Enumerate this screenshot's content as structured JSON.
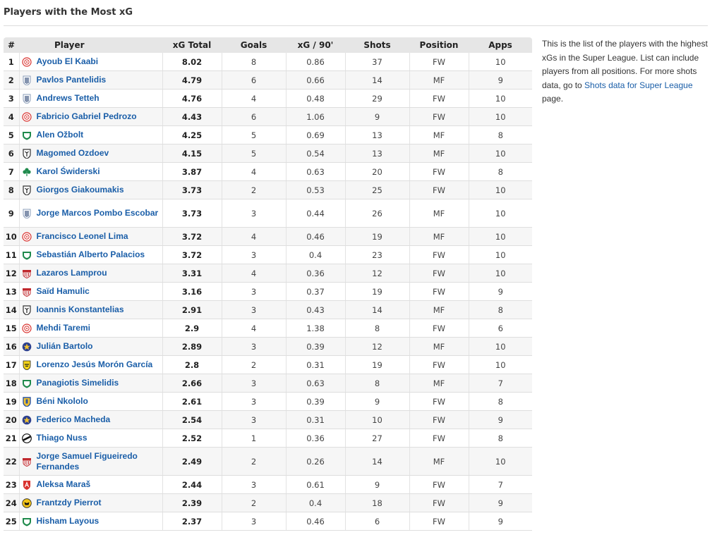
{
  "page": {
    "title": "Players with the Most xG"
  },
  "table": {
    "headers": {
      "rank": "#",
      "player": "Player",
      "xg_total": "xG Total",
      "goals": "Goals",
      "xg90": "xG / 90'",
      "shots": "Shots",
      "position": "Position",
      "apps": "Apps"
    },
    "rows": [
      {
        "rank": "1",
        "player": "Ayoub El Kaabi",
        "club_icon": "olympiacos-icon",
        "xg": "8.02",
        "goals": "8",
        "xg90": "0.86",
        "shots": "37",
        "pos": "FW",
        "apps": "10"
      },
      {
        "rank": "2",
        "player": "Pavlos Pantelidis",
        "club_icon": "atromitos-icon",
        "xg": "4.79",
        "goals": "6",
        "xg90": "0.66",
        "shots": "14",
        "pos": "MF",
        "apps": "9"
      },
      {
        "rank": "3",
        "player": "Andrews Tetteh",
        "club_icon": "atromitos-icon",
        "xg": "4.76",
        "goals": "4",
        "xg90": "0.48",
        "shots": "29",
        "pos": "FW",
        "apps": "10"
      },
      {
        "rank": "4",
        "player": "Fabricio Gabriel Pedrozo",
        "club_icon": "olympiacos-icon",
        "xg": "4.43",
        "goals": "6",
        "xg90": "1.06",
        "shots": "9",
        "pos": "FW",
        "apps": "10"
      },
      {
        "rank": "5",
        "player": "Alen Ožbolt",
        "club_icon": "panathinaikos-icon",
        "xg": "4.25",
        "goals": "5",
        "xg90": "0.69",
        "shots": "13",
        "pos": "MF",
        "apps": "8"
      },
      {
        "rank": "6",
        "player": "Magomed Ozdoev",
        "club_icon": "paok-icon",
        "xg": "4.15",
        "goals": "5",
        "xg90": "0.54",
        "shots": "13",
        "pos": "MF",
        "apps": "10"
      },
      {
        "rank": "7",
        "player": "Karol Świderski",
        "club_icon": "panathinaikos-clover-icon",
        "xg": "3.87",
        "goals": "4",
        "xg90": "0.63",
        "shots": "20",
        "pos": "FW",
        "apps": "8"
      },
      {
        "rank": "8",
        "player": "Giorgos Giakoumakis",
        "club_icon": "paok-icon",
        "xg": "3.73",
        "goals": "2",
        "xg90": "0.53",
        "shots": "25",
        "pos": "FW",
        "apps": "10"
      },
      {
        "rank": "9",
        "player": "Jorge Marcos Pombo Escobar",
        "club_icon": "atromitos-icon",
        "xg": "3.73",
        "goals": "3",
        "xg90": "0.44",
        "shots": "26",
        "pos": "MF",
        "apps": "10",
        "tall": true
      },
      {
        "rank": "10",
        "player": "Francisco Leonel Lima",
        "club_icon": "olympiacos-icon",
        "xg": "3.72",
        "goals": "4",
        "xg90": "0.46",
        "shots": "19",
        "pos": "MF",
        "apps": "10"
      },
      {
        "rank": "11",
        "player": "Sebastián Alberto Palacios",
        "club_icon": "panathinaikos-icon",
        "xg": "3.72",
        "goals": "3",
        "xg90": "0.4",
        "shots": "23",
        "pos": "FW",
        "apps": "10"
      },
      {
        "rank": "12",
        "player": "Lazaros Lamprou",
        "club_icon": "volos-icon",
        "xg": "3.31",
        "goals": "4",
        "xg90": "0.36",
        "shots": "12",
        "pos": "FW",
        "apps": "10"
      },
      {
        "rank": "13",
        "player": "Saïd Hamulic",
        "club_icon": "volos-icon",
        "xg": "3.16",
        "goals": "3",
        "xg90": "0.37",
        "shots": "19",
        "pos": "FW",
        "apps": "9"
      },
      {
        "rank": "14",
        "player": "Ioannis Konstantelias",
        "club_icon": "paok-icon",
        "xg": "2.91",
        "goals": "3",
        "xg90": "0.43",
        "shots": "14",
        "pos": "MF",
        "apps": "8"
      },
      {
        "rank": "15",
        "player": "Mehdi Taremi",
        "club_icon": "olympiacos-icon",
        "xg": "2.9",
        "goals": "4",
        "xg90": "1.38",
        "shots": "8",
        "pos": "FW",
        "apps": "6"
      },
      {
        "rank": "16",
        "player": "Julián Bartolo",
        "club_icon": "asteras-icon",
        "xg": "2.89",
        "goals": "3",
        "xg90": "0.39",
        "shots": "12",
        "pos": "MF",
        "apps": "10"
      },
      {
        "rank": "17",
        "player": "Lorenzo Jesús Morón García",
        "club_icon": "aris-icon",
        "xg": "2.8",
        "goals": "2",
        "xg90": "0.31",
        "shots": "19",
        "pos": "FW",
        "apps": "10"
      },
      {
        "rank": "18",
        "player": "Panagiotis Simelidis",
        "club_icon": "panathinaikos-icon",
        "xg": "2.66",
        "goals": "3",
        "xg90": "0.63",
        "shots": "8",
        "pos": "MF",
        "apps": "7"
      },
      {
        "rank": "19",
        "player": "Béni Nkololo",
        "club_icon": "panetolikos-icon",
        "xg": "2.61",
        "goals": "3",
        "xg90": "0.39",
        "shots": "9",
        "pos": "FW",
        "apps": "8"
      },
      {
        "rank": "20",
        "player": "Federico Macheda",
        "club_icon": "asteras-icon",
        "xg": "2.54",
        "goals": "3",
        "xg90": "0.31",
        "shots": "10",
        "pos": "FW",
        "apps": "9"
      },
      {
        "rank": "21",
        "player": "Thiago Nuss",
        "club_icon": "ofi-icon",
        "xg": "2.52",
        "goals": "1",
        "xg90": "0.36",
        "shots": "27",
        "pos": "FW",
        "apps": "8"
      },
      {
        "rank": "22",
        "player": "Jorge Samuel Figueiredo Fernandes",
        "club_icon": "volos-icon",
        "xg": "2.49",
        "goals": "2",
        "xg90": "0.26",
        "shots": "14",
        "pos": "MF",
        "apps": "10",
        "tall": true
      },
      {
        "rank": "23",
        "player": "Aleksa Maraš",
        "club_icon": "kifisia-icon",
        "xg": "2.44",
        "goals": "3",
        "xg90": "0.61",
        "shots": "9",
        "pos": "FW",
        "apps": "7"
      },
      {
        "rank": "24",
        "player": "Frantzdy Pierrot",
        "club_icon": "aek-icon",
        "xg": "2.39",
        "goals": "2",
        "xg90": "0.4",
        "shots": "18",
        "pos": "FW",
        "apps": "9"
      },
      {
        "rank": "25",
        "player": "Hisham Layous",
        "club_icon": "panathinaikos-icon",
        "xg": "2.37",
        "goals": "3",
        "xg90": "0.46",
        "shots": "6",
        "pos": "FW",
        "apps": "9"
      }
    ]
  },
  "sidebar": {
    "text_before": "This is the list of the players with the highest xGs in the Super League. List can include players from all positions. For more shots data, go to ",
    "link_text": "Shots data for Super League",
    "text_after": " page."
  },
  "colors": {
    "link": "#1a5ea8",
    "header_bg": "#e6e6e6",
    "row_alt": "#f6f6f6"
  }
}
